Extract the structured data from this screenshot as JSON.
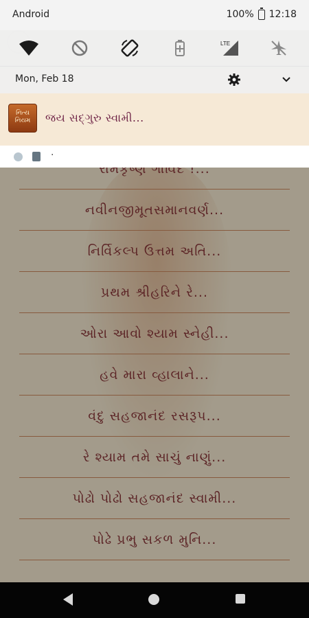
{
  "status_bar": {
    "carrier": "Android",
    "battery": "100%",
    "time": "12:18"
  },
  "quick_tiles": [
    {
      "name": "wifi-icon"
    },
    {
      "name": "dnd-off-icon"
    },
    {
      "name": "rotate-icon"
    },
    {
      "name": "battery-saver-icon"
    },
    {
      "name": "lte-signal-icon",
      "label": "LTE"
    },
    {
      "name": "airplane-mode-icon"
    }
  ],
  "shade": {
    "date": "Mon, Feb 18"
  },
  "notification": {
    "app_icon_text": "નિત્ય નિયમ",
    "title": "જય સદ્ગુરુ સ્વામી..."
  },
  "mini_bar": {
    "dot": "·"
  },
  "song_list": [
    "રામકૃષ્ણ ગોવિંદ !...",
    "નવીનજીમૂતસમાનવર્ણ...",
    "નિર્વિકલ્પ ઉત્તમ અતિ...",
    "પ્રથમ શ્રીહરિને રે...",
    "ઓરા આવો શ્યામ સ્નેહી...",
    "હવે મારા વ્હાલાને...",
    "વંદુ સહજાનંદ રસરૂપ...",
    "રે શ્યામ તમે સાચું નાણું...",
    "પોઢો પોઢો સહજાનંદ સ્વામી...",
    "પોઢે પ્રભુ સકળ મુનિ...",
    "..."
  ]
}
